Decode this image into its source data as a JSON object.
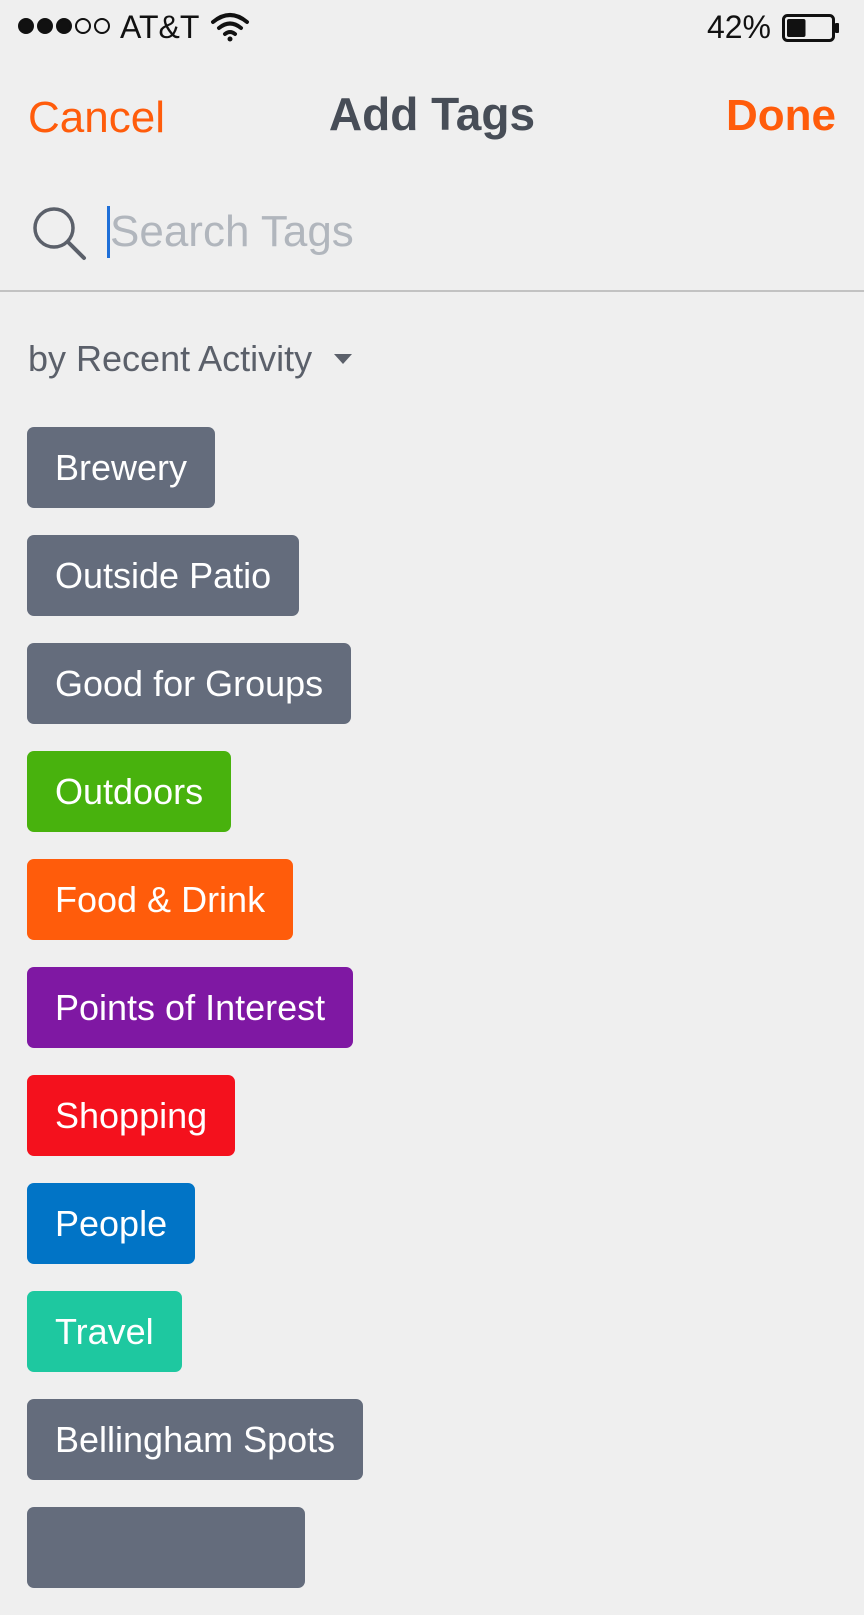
{
  "status_bar": {
    "carrier": "AT&T",
    "signal_strength": 3,
    "signal_max": 5,
    "battery_percent_label": "42%",
    "battery_level": 0.42
  },
  "nav": {
    "cancel_label": "Cancel",
    "title": "Add Tags",
    "done_label": "Done"
  },
  "search": {
    "placeholder": "Search Tags",
    "value": ""
  },
  "sort": {
    "label": "by Recent Activity"
  },
  "colors": {
    "accent": "#ff5c0b",
    "gray_tag": "#646c7c",
    "green_tag": "#48b20d",
    "orange_tag": "#ff5c0b",
    "purple_tag": "#7f18a3",
    "red_tag": "#f4111d",
    "blue_tag": "#0174c6",
    "teal_tag": "#1ec8a0"
  },
  "tags": [
    {
      "label": "Brewery",
      "color": "#646c7c"
    },
    {
      "label": "Outside Patio",
      "color": "#646c7c"
    },
    {
      "label": "Good for Groups",
      "color": "#646c7c"
    },
    {
      "label": "Outdoors",
      "color": "#48b20d"
    },
    {
      "label": "Food & Drink",
      "color": "#ff5c0b"
    },
    {
      "label": "Points of Interest",
      "color": "#7f18a3"
    },
    {
      "label": "Shopping",
      "color": "#f4111d"
    },
    {
      "label": "People",
      "color": "#0174c6"
    },
    {
      "label": "Travel",
      "color": "#1ec8a0"
    },
    {
      "label": "Bellingham Spots",
      "color": "#646c7c"
    },
    {
      "label": "",
      "color": "#646c7c"
    }
  ]
}
